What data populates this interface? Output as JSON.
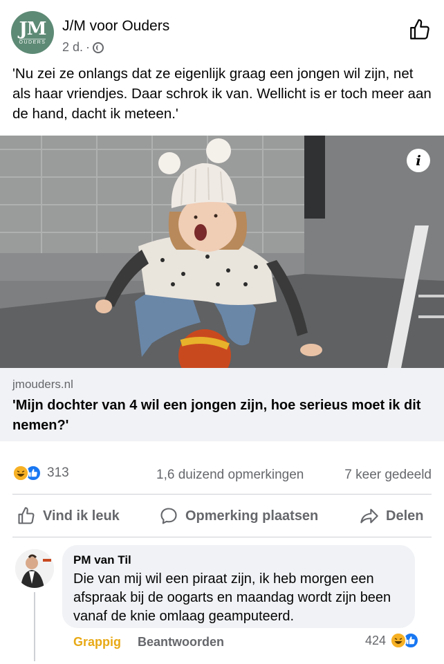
{
  "post": {
    "page_name": "J/M voor Ouders",
    "avatar_text": "JM",
    "avatar_subtext": "OUDERS",
    "time": "2 d.",
    "separator": "·",
    "text": "'Nu zei ze onlangs dat ze eigenlijk graag een jongen wil zijn, net als haar vriendjes. Daar schrok ik van. Wellicht is er toch meer aan de hand, dacht ik meteen.'",
    "info_icon": "i"
  },
  "link": {
    "domain": "jmouders.nl",
    "title": "'Mijn dochter van 4 wil een jongen zijn, hoe serieus moet ik dit nemen?'"
  },
  "stats": {
    "reaction_count": "313",
    "comments": "1,6 duizend opmerkingen",
    "shares": "7 keer gedeeld"
  },
  "actions": {
    "like": "Vind ik leuk",
    "comment": "Opmerking plaatsen",
    "share": "Delen"
  },
  "comment": {
    "author": "PM van Til",
    "text": "Die van mij wil een piraat zijn, ik heb morgen een afspraak bij de oogarts en maandag wordt zijn been vanaf de knie omlaag geamputeerd.",
    "reaction_label": "Grappig",
    "reply_label": "Beantwoorden",
    "reaction_count": "424"
  },
  "icons": {
    "avatar": "jm-ouders-logo",
    "globe": "globe-icon",
    "thumbs_up": "thumbs-up-icon",
    "comment": "speech-bubble-icon",
    "share": "share-arrow-icon",
    "info": "info-icon",
    "haha": "haha-reaction-icon",
    "like": "like-reaction-icon"
  },
  "colors": {
    "accent_blue": "#1877f2",
    "haha_yellow": "#f7b125",
    "funny_label": "#e8a916",
    "secondary_text": "#65676b",
    "card_bg": "#f0f2f5",
    "avatar_green": "#5d8a75"
  }
}
